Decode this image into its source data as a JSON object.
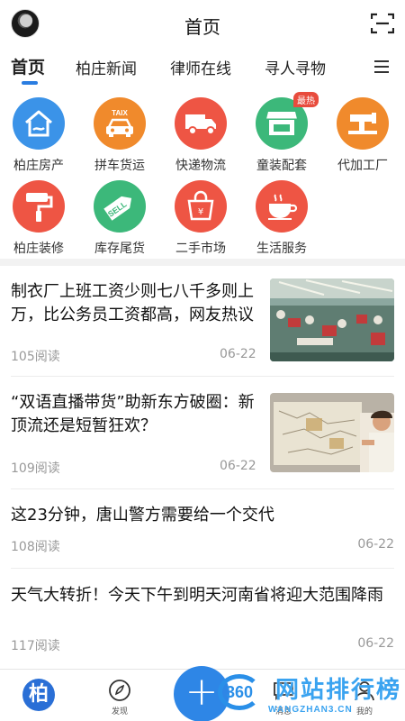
{
  "header": {
    "title": "首页",
    "avatar_icon": "user-avatar",
    "scan_icon": "scan-icon"
  },
  "tabs": [
    {
      "label": "首页",
      "active": true
    },
    {
      "label": "柏庄新闻",
      "active": false
    },
    {
      "label": "律师在线",
      "active": false
    },
    {
      "label": "寻人寻物",
      "active": false
    }
  ],
  "categories": [
    {
      "label": "柏庄房产",
      "icon": "house-icon",
      "color": "#3b93e8"
    },
    {
      "label": "拼车货运",
      "icon": "taxi-icon",
      "color": "#f08a2c"
    },
    {
      "label": "快递物流",
      "icon": "truck-icon",
      "color": "#ee5544"
    },
    {
      "label": "童装配套",
      "icon": "shop-icon",
      "color": "#3cb87a",
      "badge": "最热"
    },
    {
      "label": "代加工厂",
      "icon": "sewing-machine-icon",
      "color": "#f08a2c"
    },
    {
      "label": "柏庄装修",
      "icon": "paint-roller-icon",
      "color": "#ee5544"
    },
    {
      "label": "库存尾货",
      "icon": "sell-tag-icon",
      "color": "#3cb87a"
    },
    {
      "label": "二手市场",
      "icon": "shopping-bag-icon",
      "color": "#ee5544"
    },
    {
      "label": "生活服务",
      "icon": "coffee-cup-icon",
      "color": "#ee5544"
    }
  ],
  "news": [
    {
      "title": "制衣厂上班工资少则七八千多则上万，比公务员工资都高，网友热议",
      "reads": "105阅读",
      "date": "06-22",
      "thumb": "factory-photo"
    },
    {
      "title": "“双语直播带货”助新东方破圈：新顶流还是短暂狂欢？",
      "reads": "109阅读",
      "date": "06-22",
      "thumb": "map-teacher-photo"
    },
    {
      "title": "这23分钟，唐山警方需要给一个交代",
      "reads": "108阅读",
      "date": "06-22"
    },
    {
      "title": "天气大转折！今天下午到明天河南省将迎大范围降雨",
      "reads": "117阅读",
      "date": "06-22"
    }
  ],
  "bottom_nav": {
    "home_char": "柏",
    "discover": "发现",
    "messages": "消息",
    "profile": "我的",
    "plus": "+"
  },
  "watermark": {
    "logo": "360",
    "text": "网站排行榜",
    "sub": "WANGZHAN3.CN"
  },
  "colors": {
    "accent": "#2a7de1",
    "divider": "#f2f2f2",
    "meta": "#999999"
  }
}
